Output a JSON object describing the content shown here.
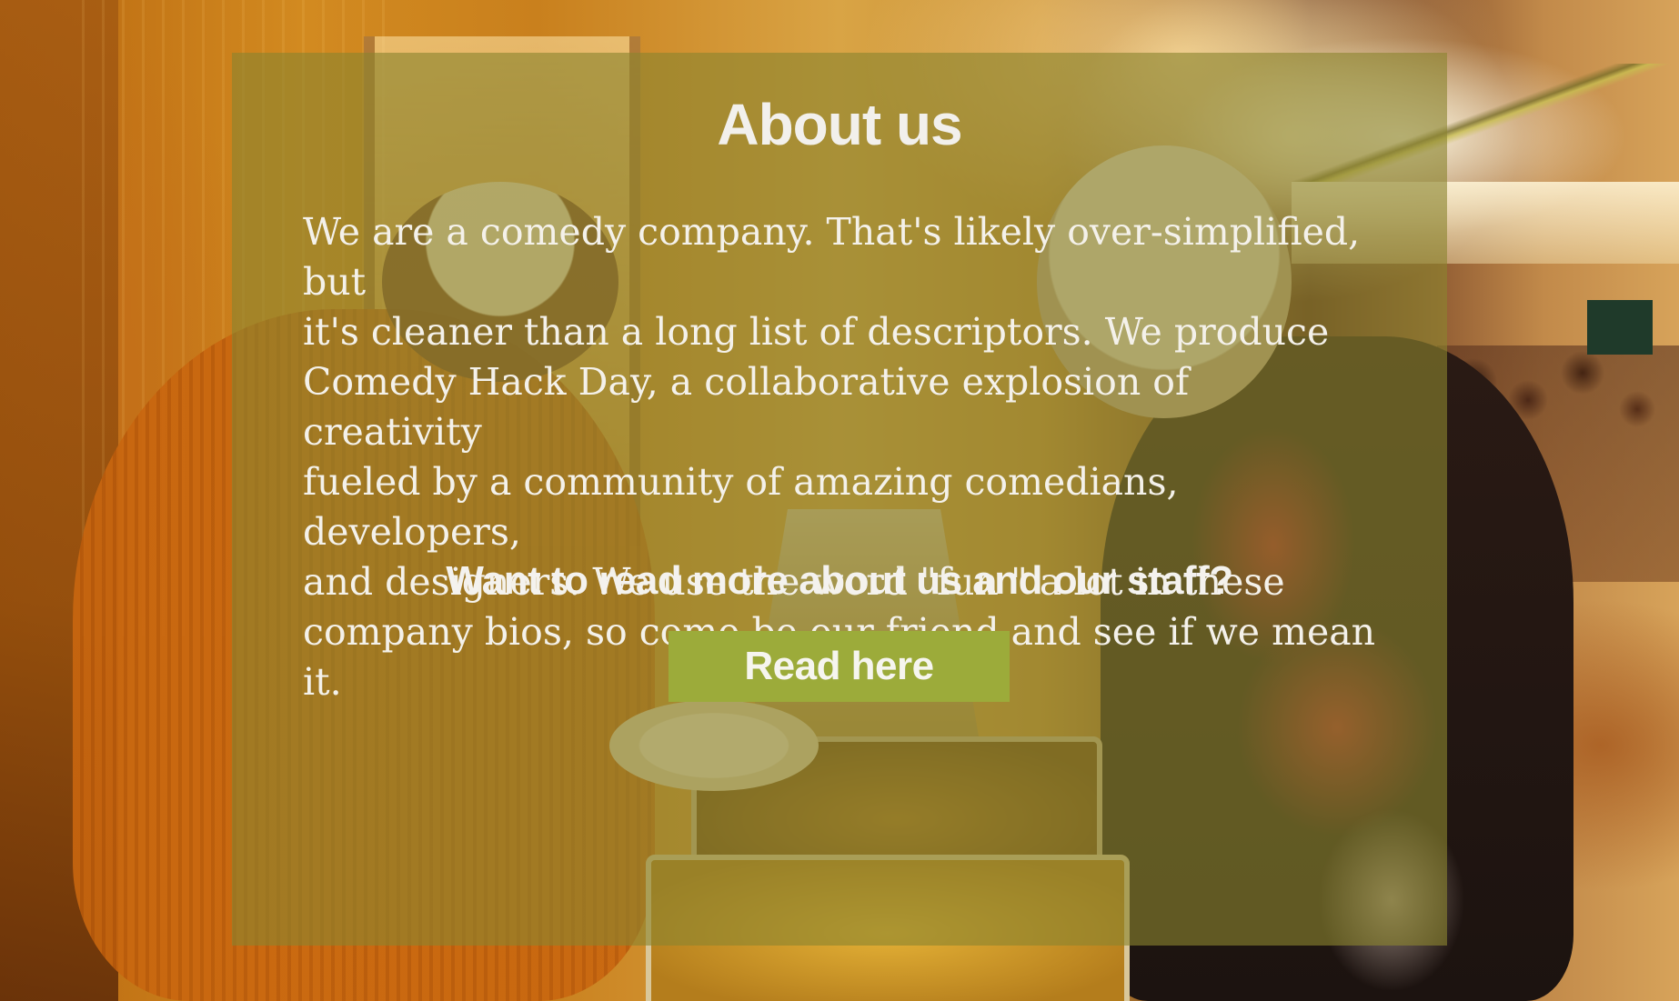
{
  "about": {
    "title": "About us",
    "body": "We are a comedy company. That's likely over-simplified, but\nit's cleaner than a long list of descriptors. We produce\nComedy Hack Day, a collaborative explosion of creativity\nfueled by a community of amazing comedians, developers,\nand designers. We use the word  \"fun \" a lot in these\ncompany bios, so come be our friend and see if we mean it.",
    "cta_heading": "Want to read more about us and our staff?",
    "button_label": "Read here"
  },
  "colors": {
    "overlay": "#8b842e",
    "button": "#9cab3a",
    "text": "#f4f1ea"
  }
}
